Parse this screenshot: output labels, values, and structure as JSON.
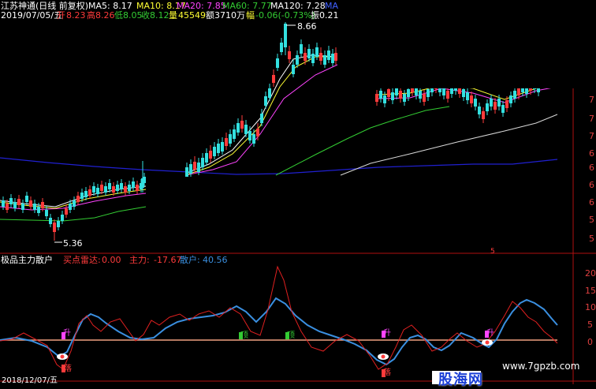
{
  "colors": {
    "bg": "#000000",
    "up": "#33e0e0",
    "red": "#ff3b3b",
    "white": "#ffffff",
    "yellow": "#ffff33",
    "magenta": "#ff44ff",
    "green": "#33cc33",
    "blue": "#2020d0",
    "grey": "#d8d8d8",
    "axis": "#b01010",
    "main_line": "#e02020",
    "retail_line": "#3a8fe0",
    "baseline": "#f0a080"
  },
  "header": {
    "stock": "江苏神通(日线 前复权)",
    "ma5": "MA5: 8.17",
    "ma10": "MA10: 8.17",
    "ma20": "MA20: 7.85",
    "ma60": "MA60: 7.77",
    "ma120": "MA120: 7.28",
    "ma_cut": "MA",
    "date": "2019/07/05/五",
    "open_label": "开",
    "open": "8.23",
    "high_label": "高",
    "high": "8.26",
    "low_label": "低",
    "low": "8.05",
    "close_label": "收",
    "close": "8.12",
    "vol_label": "量",
    "vol": "45549",
    "amt_label": "额",
    "amt": "3710万",
    "chg_label": "幅",
    "chg": "-0.06(-0.73%)",
    "amp_label": "振",
    "amp": "0.21"
  },
  "price_notes": {
    "high_mark": "8.66",
    "low_mark": "5.36",
    "marker": "5"
  },
  "indicator_header": {
    "name": "极品主力散户",
    "radar_label": "买点雷达:",
    "radar_value": "0.00",
    "main_label": "主力:",
    "main_value": "-17.67",
    "retail_label": "散户:",
    "retail_value": "40.56"
  },
  "signals": {
    "up": "升",
    "down": "落",
    "top": "顶"
  },
  "footer_date": "2018/12/07/五",
  "watermark": {
    "brand": "股海网",
    "url": "www.7gpzb.com"
  },
  "chart_data": [
    {
      "type": "candlestick",
      "title": "江苏神通(日线 前复权)",
      "y_axis_ticks": [
        "7",
        "7",
        "7",
        "6",
        "6",
        "6",
        "6",
        "5",
        "5"
      ],
      "annotations": [
        "8.66",
        "5.36"
      ],
      "series": [
        {
          "name": "MA5",
          "value": 8.17
        },
        {
          "name": "MA10",
          "value": 8.17
        },
        {
          "name": "MA20",
          "value": 7.85
        },
        {
          "name": "MA60",
          "value": 7.77
        },
        {
          "name": "MA120",
          "value": 7.28
        }
      ]
    },
    {
      "type": "line",
      "title": "极品主力散户",
      "y_axis_ticks": [
        "20",
        "15",
        "10",
        "5",
        "0"
      ],
      "ylim": [
        -5,
        22
      ],
      "series": [
        {
          "name": "主力",
          "last": -17.67
        },
        {
          "name": "散户",
          "last": 40.56
        },
        {
          "name": "买点雷达",
          "last": 0.0
        }
      ]
    }
  ]
}
